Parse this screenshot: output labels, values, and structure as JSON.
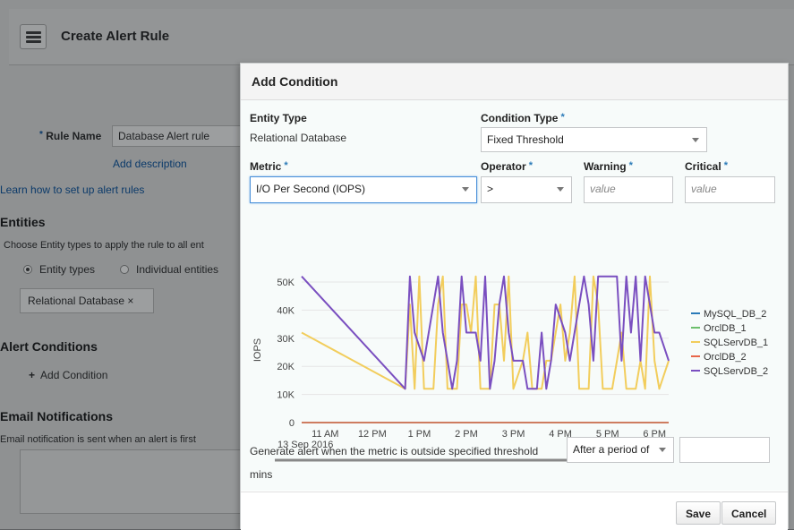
{
  "header": {
    "title": "Create Alert Rule",
    "menu_icon": "hamburger-menu-icon"
  },
  "background_form": {
    "rule_name_label": "Rule Name",
    "rule_name_value": "Database Alert rule",
    "add_description": "Add description",
    "learn_link": "Learn how to set up alert rules",
    "entities_heading": "Entities",
    "entities_hint": "Choose Entity types to apply the rule to all ent",
    "radio_entity_types": "Entity types",
    "radio_individual": "Individual entities",
    "entity_tag": "Relational Database ×",
    "alert_conditions_heading": "Alert Conditions",
    "add_condition": "Add Condition",
    "email_heading": "Email Notifications",
    "email_hint": "Email notification is sent when an alert is first"
  },
  "dialog": {
    "title": "Add Condition",
    "entity_type_label": "Entity Type",
    "entity_type_value": "Relational Database",
    "condition_type_label": "Condition Type",
    "condition_type_value": "Fixed Threshold",
    "metric_label": "Metric",
    "metric_value": "I/O Per Second (IOPS)",
    "operator_label": "Operator",
    "operator_value": ">",
    "warning_label": "Warning",
    "warning_placeholder": "value",
    "critical_label": "Critical",
    "critical_placeholder": "value",
    "threshold_text": "Generate alert when the metric is outside specified threshold",
    "period_select": "After a period of",
    "period_input_value": "",
    "mins_text": "mins",
    "save_label": "Save",
    "cancel_label": "Cancel",
    "required_mark": "*"
  },
  "chart_data": {
    "type": "line",
    "ylabel": "IOPS",
    "xlabel": "",
    "ylim": [
      0,
      50000
    ],
    "yticks": [
      "0",
      "10K",
      "20K",
      "30K",
      "40K",
      "50K"
    ],
    "xticks": [
      "11 AM",
      "12 PM",
      "1 PM",
      "2 PM",
      "3 PM",
      "4 PM",
      "5 PM",
      "6 PM"
    ],
    "date_label": "13 Sep 2016",
    "legend_position": "right",
    "series": [
      {
        "name": "MySQL_DB_2",
        "color": "#2a7ab8",
        "points": [
          [
            10.5,
            0
          ],
          [
            18.3,
            0
          ]
        ]
      },
      {
        "name": "OrclDB_1",
        "color": "#6cbf6c",
        "points": [
          [
            10.5,
            0
          ],
          [
            18.3,
            0
          ]
        ]
      },
      {
        "name": "SQLServDB_1",
        "color": "#f2cd5c",
        "points": [
          [
            10.5,
            32000
          ],
          [
            12.7,
            12000
          ],
          [
            12.8,
            42000
          ],
          [
            12.9,
            12000
          ],
          [
            13.0,
            52000
          ],
          [
            13.1,
            12000
          ],
          [
            13.3,
            12000
          ],
          [
            13.4,
            42000
          ],
          [
            13.5,
            52000
          ],
          [
            13.6,
            12000
          ],
          [
            13.8,
            12000
          ],
          [
            13.9,
            42000
          ],
          [
            14.0,
            42000
          ],
          [
            14.1,
            32000
          ],
          [
            14.2,
            52000
          ],
          [
            14.3,
            12000
          ],
          [
            14.5,
            12000
          ],
          [
            14.6,
            42000
          ],
          [
            14.7,
            42000
          ],
          [
            14.8,
            22000
          ],
          [
            14.9,
            52000
          ],
          [
            15.0,
            12000
          ],
          [
            15.2,
            22000
          ],
          [
            15.3,
            32000
          ],
          [
            15.4,
            12000
          ],
          [
            15.6,
            12000
          ],
          [
            15.7,
            22000
          ],
          [
            15.8,
            22000
          ],
          [
            15.9,
            32000
          ],
          [
            16.0,
            42000
          ],
          [
            16.1,
            22000
          ],
          [
            16.2,
            32000
          ],
          [
            16.3,
            52000
          ],
          [
            16.4,
            12000
          ],
          [
            16.6,
            12000
          ],
          [
            16.7,
            52000
          ],
          [
            16.8,
            42000
          ],
          [
            16.9,
            12000
          ],
          [
            17.1,
            12000
          ],
          [
            17.2,
            22000
          ],
          [
            17.3,
            32000
          ],
          [
            17.4,
            12000
          ],
          [
            17.6,
            12000
          ],
          [
            17.7,
            22000
          ],
          [
            17.8,
            12000
          ],
          [
            17.9,
            52000
          ],
          [
            18.0,
            22000
          ],
          [
            18.1,
            12000
          ],
          [
            18.3,
            22000
          ]
        ]
      },
      {
        "name": "OrclDB_2",
        "color": "#e8664a",
        "points": [
          [
            10.5,
            0
          ],
          [
            18.3,
            0
          ]
        ]
      },
      {
        "name": "SQLServDB_2",
        "color": "#7a4fc0",
        "points": [
          [
            10.5,
            52000
          ],
          [
            12.7,
            12000
          ],
          [
            12.8,
            52000
          ],
          [
            12.9,
            32000
          ],
          [
            13.1,
            22000
          ],
          [
            13.3,
            42000
          ],
          [
            13.4,
            52000
          ],
          [
            13.5,
            32000
          ],
          [
            13.7,
            12000
          ],
          [
            13.8,
            22000
          ],
          [
            13.9,
            52000
          ],
          [
            14.0,
            32000
          ],
          [
            14.2,
            32000
          ],
          [
            14.3,
            22000
          ],
          [
            14.4,
            52000
          ],
          [
            14.5,
            12000
          ],
          [
            14.6,
            22000
          ],
          [
            14.7,
            42000
          ],
          [
            14.8,
            52000
          ],
          [
            14.9,
            32000
          ],
          [
            15.0,
            22000
          ],
          [
            15.2,
            22000
          ],
          [
            15.3,
            12000
          ],
          [
            15.5,
            12000
          ],
          [
            15.6,
            32000
          ],
          [
            15.7,
            12000
          ],
          [
            15.8,
            22000
          ],
          [
            15.9,
            42000
          ],
          [
            16.1,
            32000
          ],
          [
            16.2,
            22000
          ],
          [
            16.4,
            42000
          ],
          [
            16.5,
            52000
          ],
          [
            16.6,
            42000
          ],
          [
            16.7,
            22000
          ],
          [
            16.8,
            52000
          ],
          [
            17.2,
            52000
          ],
          [
            17.3,
            22000
          ],
          [
            17.4,
            52000
          ],
          [
            17.5,
            32000
          ],
          [
            17.6,
            52000
          ],
          [
            17.7,
            22000
          ],
          [
            17.8,
            52000
          ],
          [
            17.9,
            42000
          ],
          [
            18.0,
            32000
          ],
          [
            18.1,
            32000
          ],
          [
            18.3,
            22000
          ]
        ]
      }
    ]
  }
}
